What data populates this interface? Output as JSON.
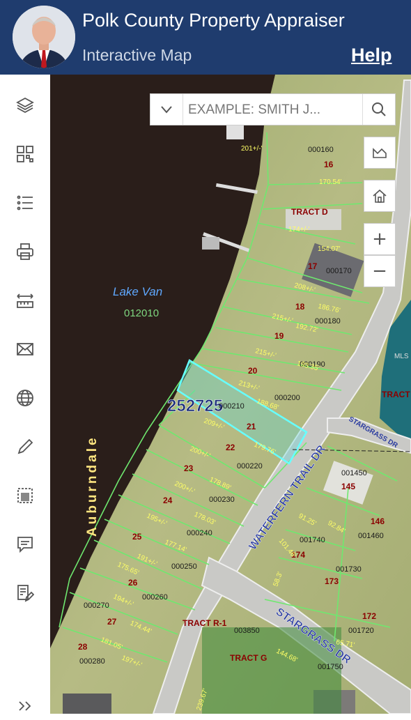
{
  "header": {
    "title": "Polk County Property Appraiser",
    "subtitle": "Interactive Map",
    "help_label": "Help"
  },
  "search": {
    "placeholder": "EXAMPLE: SMITH J..."
  },
  "map_controls": {
    "zoom_in": "+",
    "zoom_out": "−"
  },
  "sidebar": {
    "items": [
      "layers-icon",
      "qr-code-icon",
      "legend-list-icon",
      "print-icon",
      "measure-icon",
      "email-icon",
      "globe-icon",
      "pencil-icon",
      "select-area-icon",
      "comment-icon",
      "edit-form-icon",
      "expand-icon"
    ]
  },
  "map": {
    "lake_name": "Lake Van",
    "lake_id": "012010",
    "city": "Auburndale",
    "highlighted_parcel": "252725",
    "roads": [
      "WATERFERN TRAIL DR",
      "STARGRASS DR",
      "STARGRASS DR"
    ],
    "tracts": [
      "TRACT D",
      "TRACT E",
      "TRACT R-1",
      "TRACT G"
    ],
    "lot_numbers": [
      "16",
      "17",
      "18",
      "19",
      "20",
      "21",
      "22",
      "23",
      "24",
      "25",
      "26",
      "27",
      "28",
      "145",
      "146",
      "172",
      "173",
      "174"
    ],
    "parcel_ids": [
      "000160",
      "000170",
      "000180",
      "000190",
      "000200",
      "000210",
      "000220",
      "000230",
      "000240",
      "000250",
      "000260",
      "000270",
      "000280",
      "001450",
      "001460",
      "001720",
      "001730",
      "001740",
      "003850",
      "001750"
    ],
    "dimensions": [
      "170.54'",
      "154.07'",
      "186.76'",
      "192.72'",
      "193.35'",
      "188.68'",
      "179.76'",
      "178.89'",
      "178.03'",
      "177.14'",
      "175.65'",
      "174.44'",
      "181.05'",
      "208+/-'",
      "215+/-'",
      "215+/-'",
      "213+/-'",
      "209+/-'",
      "200+/-'",
      "200+/-'",
      "195+/-'",
      "191+/-'",
      "194+/-'",
      "197+/-'",
      "174+/-'",
      "201+/-'",
      "144.68'",
      "239.67'",
      "65.71'",
      "91.25'",
      "92.84'",
      "101.46'",
      "58.3'"
    ],
    "watermark": "MLS"
  }
}
